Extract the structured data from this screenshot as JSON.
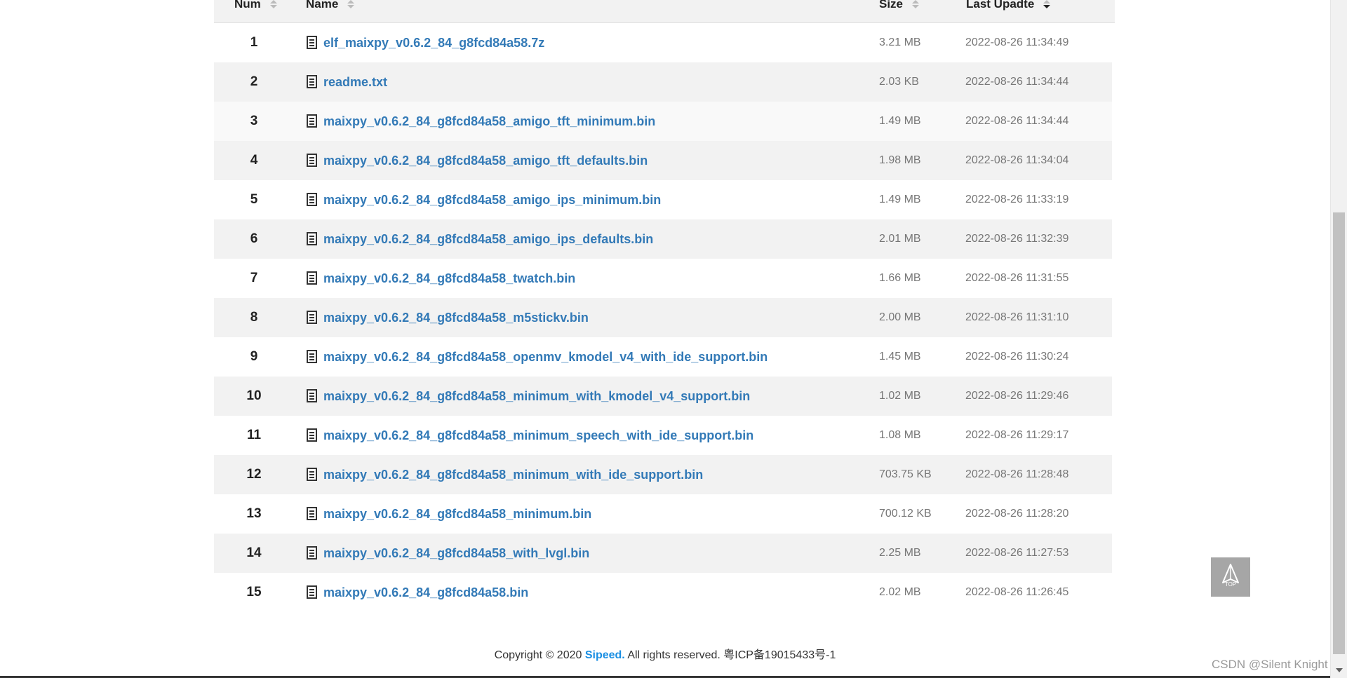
{
  "table": {
    "headers": {
      "num": "Num",
      "name": "Name",
      "size": "Size",
      "date": "Last Upadte"
    },
    "rows": [
      {
        "num": "1",
        "name": "elf_maixpy_v0.6.2_84_g8fcd84a58.7z",
        "size": "3.21 MB",
        "date": "2022-08-26 11:34:49"
      },
      {
        "num": "2",
        "name": "readme.txt",
        "size": "2.03 KB",
        "date": "2022-08-26 11:34:44"
      },
      {
        "num": "3",
        "name": "maixpy_v0.6.2_84_g8fcd84a58_amigo_tft_minimum.bin",
        "size": "1.49 MB",
        "date": "2022-08-26 11:34:44"
      },
      {
        "num": "4",
        "name": "maixpy_v0.6.2_84_g8fcd84a58_amigo_tft_defaults.bin",
        "size": "1.98 MB",
        "date": "2022-08-26 11:34:04"
      },
      {
        "num": "5",
        "name": "maixpy_v0.6.2_84_g8fcd84a58_amigo_ips_minimum.bin",
        "size": "1.49 MB",
        "date": "2022-08-26 11:33:19"
      },
      {
        "num": "6",
        "name": "maixpy_v0.6.2_84_g8fcd84a58_amigo_ips_defaults.bin",
        "size": "2.01 MB",
        "date": "2022-08-26 11:32:39"
      },
      {
        "num": "7",
        "name": "maixpy_v0.6.2_84_g8fcd84a58_twatch.bin",
        "size": "1.66 MB",
        "date": "2022-08-26 11:31:55"
      },
      {
        "num": "8",
        "name": "maixpy_v0.6.2_84_g8fcd84a58_m5stickv.bin",
        "size": "2.00 MB",
        "date": "2022-08-26 11:31:10"
      },
      {
        "num": "9",
        "name": "maixpy_v0.6.2_84_g8fcd84a58_openmv_kmodel_v4_with_ide_support.bin",
        "size": "1.45 MB",
        "date": "2022-08-26 11:30:24"
      },
      {
        "num": "10",
        "name": "maixpy_v0.6.2_84_g8fcd84a58_minimum_with_kmodel_v4_support.bin",
        "size": "1.02 MB",
        "date": "2022-08-26 11:29:46"
      },
      {
        "num": "11",
        "name": "maixpy_v0.6.2_84_g8fcd84a58_minimum_speech_with_ide_support.bin",
        "size": "1.08 MB",
        "date": "2022-08-26 11:29:17"
      },
      {
        "num": "12",
        "name": "maixpy_v0.6.2_84_g8fcd84a58_minimum_with_ide_support.bin",
        "size": "703.75 KB",
        "date": "2022-08-26 11:28:48"
      },
      {
        "num": "13",
        "name": "maixpy_v0.6.2_84_g8fcd84a58_minimum.bin",
        "size": "700.12 KB",
        "date": "2022-08-26 11:28:20"
      },
      {
        "num": "14",
        "name": "maixpy_v0.6.2_84_g8fcd84a58_with_lvgl.bin",
        "size": "2.25 MB",
        "date": "2022-08-26 11:27:53"
      },
      {
        "num": "15",
        "name": "maixpy_v0.6.2_84_g8fcd84a58.bin",
        "size": "2.02 MB",
        "date": "2022-08-26 11:26:45"
      }
    ]
  },
  "footer": {
    "prefix": "Copyright © 2020 ",
    "brand": "Sipeed.",
    "suffix": " All rights reserved. 粤ICP备19015433号-1"
  },
  "back_to_top": {
    "label": "TOP",
    "icon": "up-arrow-icon"
  },
  "watermark": "CSDN @Silent Knight",
  "colors": {
    "link": "#337ab7",
    "brand": "#1a8fe3",
    "row_alt": "#f2f2f2",
    "back_top_bg": "#a6a6a6"
  }
}
